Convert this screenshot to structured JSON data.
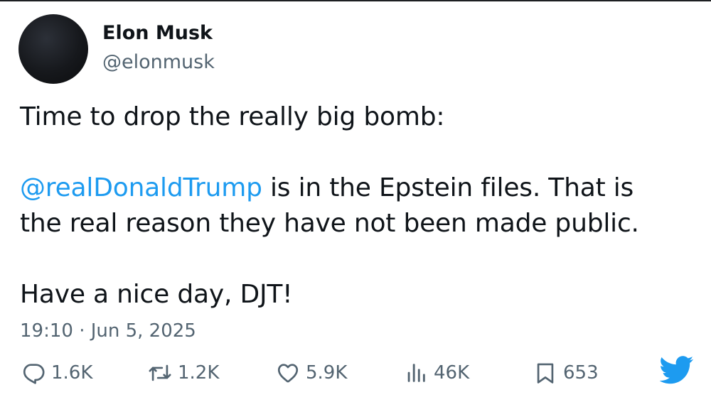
{
  "author": {
    "display_name": "Elon Musk",
    "handle": "@elonmusk"
  },
  "tweet": {
    "line1": "Time to drop the really big bomb:",
    "mention": "@realDonaldTrump",
    "line2_rest": " is in the Epstein files. That is",
    "line3": "the real reason they have not been made public.",
    "line4": "Have a nice day, DJT!"
  },
  "timestamp": "19:10 · Jun 5, 2025",
  "actions": {
    "reply": {
      "icon": "reply-icon",
      "count": "1.6K"
    },
    "retweet": {
      "icon": "retweet-icon",
      "count": "1.2K"
    },
    "like": {
      "icon": "heart-icon",
      "count": "5.9K"
    },
    "views": {
      "icon": "views-icon",
      "count": "46K"
    },
    "bookmark": {
      "icon": "bookmark-icon",
      "count": "653"
    }
  },
  "brand": {
    "icon": "twitter-bird-icon",
    "color": "#1d9bf0"
  },
  "colors": {
    "text": "#0f1419",
    "secondary": "#536471",
    "link": "#1d9bf0"
  }
}
